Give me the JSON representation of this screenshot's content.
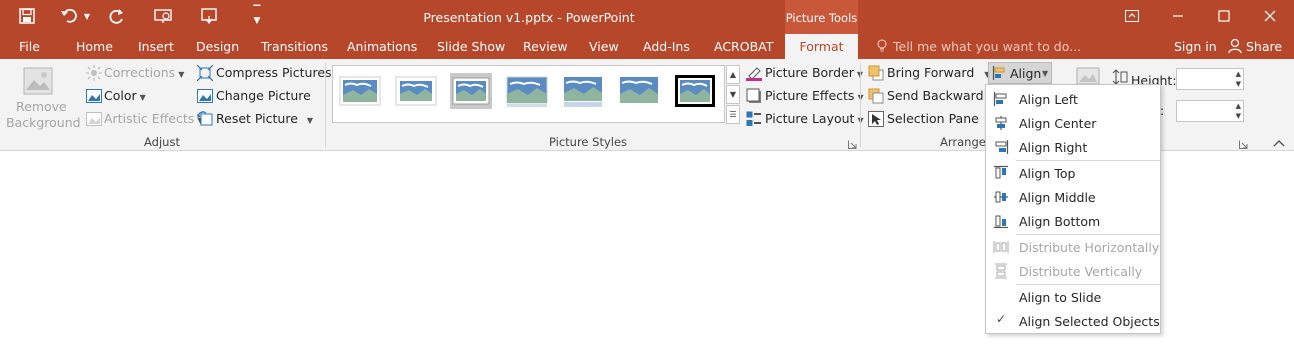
{
  "app": {
    "title": "Presentation v1.pptx - PowerPoint",
    "context_tab_group": "Picture Tools",
    "brand_color": "#b7472a"
  },
  "qat": {
    "icons": [
      "save-icon",
      "undo-icon",
      "redo-icon",
      "slideshow-from-start-icon",
      "touch-mode-icon",
      "customize-qat-icon"
    ]
  },
  "window_controls": [
    "ribbon-display-options-icon",
    "minimize-icon",
    "maximize-icon",
    "close-icon"
  ],
  "tabs": {
    "file": "File",
    "home": "Home",
    "insert": "Insert",
    "design": "Design",
    "transitions": "Transitions",
    "animations": "Animations",
    "slideshow": "Slide Show",
    "review": "Review",
    "view": "View",
    "addins": "Add-Ins",
    "acrobat": "ACROBAT",
    "format": "Format",
    "tell_me": "Tell me what you want to do...",
    "sign_in": "Sign in",
    "share": "Share"
  },
  "ribbon": {
    "adjust": {
      "remove_bg_line1": "Remove",
      "remove_bg_line2": "Background",
      "corrections": "Corrections",
      "color": "Color",
      "artistic_effects": "Artistic Effects",
      "compress": "Compress Pictures",
      "change": "Change Picture",
      "reset": "Reset Picture",
      "group_label": "Adjust"
    },
    "picture_styles": {
      "group_label": "Picture Styles",
      "picture_border": "Picture Border",
      "picture_effects": "Picture Effects",
      "picture_layout": "Picture Layout",
      "style_count": 7,
      "selected_index": 2
    },
    "arrange": {
      "bring_forward": "Bring Forward",
      "send_backward": "Send Backward",
      "selection_pane": "Selection Pane",
      "align": "Align",
      "group_label": "Arrange"
    },
    "size": {
      "height_label": "Height:"
    }
  },
  "align_menu": {
    "items": [
      {
        "label": "Align Left",
        "enabled": true,
        "icon": "align-left-icon"
      },
      {
        "label": "Align Center",
        "enabled": true,
        "icon": "align-center-icon"
      },
      {
        "label": "Align Right",
        "enabled": true,
        "icon": "align-right-icon"
      },
      {
        "label": "Align Top",
        "enabled": true,
        "icon": "align-top-icon"
      },
      {
        "label": "Align Middle",
        "enabled": true,
        "icon": "align-middle-icon"
      },
      {
        "label": "Align Bottom",
        "enabled": true,
        "icon": "align-bottom-icon"
      },
      {
        "label": "Distribute Horizontally",
        "enabled": false,
        "icon": "distribute-horizontally-icon"
      },
      {
        "label": "Distribute Vertically",
        "enabled": false,
        "icon": "distribute-vertically-icon"
      },
      {
        "label": "Align to Slide",
        "enabled": true,
        "checked": false
      },
      {
        "label": "Align Selected Objects",
        "enabled": true,
        "checked": true
      }
    ]
  }
}
